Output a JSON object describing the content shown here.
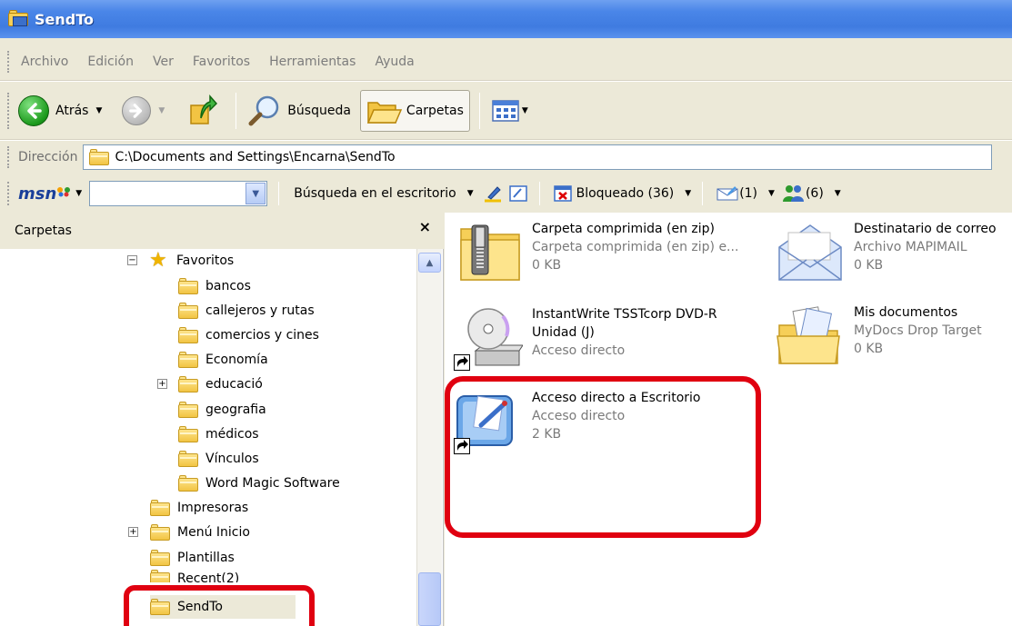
{
  "window": {
    "title": "SendTo"
  },
  "menu": [
    "Archivo",
    "Edición",
    "Ver",
    "Favoritos",
    "Herramientas",
    "Ayuda"
  ],
  "toolbar": {
    "back_label": "Atrás",
    "search_label": "Búsqueda",
    "folders_label": "Carpetas"
  },
  "address": {
    "label": "Dirección",
    "path": "C:\\Documents and Settings\\Encarna\\SendTo"
  },
  "msn": {
    "logo": "msn",
    "search_value": "",
    "desktop_search": "Búsqueda en el escritorio",
    "blocked": "Bloqueado (36)",
    "mail_count": "(1)",
    "contacts_count": "(6)"
  },
  "folders_pane": {
    "title": "Carpetas",
    "close": "×",
    "items": [
      {
        "label": "Favoritos",
        "expander": "−"
      },
      {
        "label": "bancos"
      },
      {
        "label": "callejeros y rutas"
      },
      {
        "label": "comercios y cines"
      },
      {
        "label": "Economía"
      },
      {
        "label": "educació",
        "expander": "+"
      },
      {
        "label": "geografia"
      },
      {
        "label": "médicos"
      },
      {
        "label": "Vínculos"
      },
      {
        "label": "Word Magic Software"
      },
      {
        "label": "Impresoras"
      },
      {
        "label": "Menú Inicio",
        "expander": "+"
      },
      {
        "label": "Plantillas"
      },
      {
        "label": "Recent(2)"
      },
      {
        "label": "SendTo"
      }
    ]
  },
  "files": [
    {
      "name": "Carpeta comprimida (en zip)",
      "type": "Carpeta comprimida (en zip) e...",
      "size": "0 KB"
    },
    {
      "name": "Destinatario de correo",
      "type": "Archivo MAPIMAIL",
      "size": "0 KB"
    },
    {
      "name": "InstantWrite TSSTcorp DVD-R",
      "name2": "Unidad (J)",
      "type": "Acceso directo"
    },
    {
      "name": "Mis documentos",
      "type": "MyDocs Drop Target",
      "size": "0 KB"
    },
    {
      "name": "Acceso directo a Escritorio",
      "type": "Acceso directo",
      "size": "2 KB"
    }
  ],
  "colors": {
    "titlebar": "#3f7be0",
    "highlight": "#e00010",
    "chrome": "#ece9d8"
  }
}
